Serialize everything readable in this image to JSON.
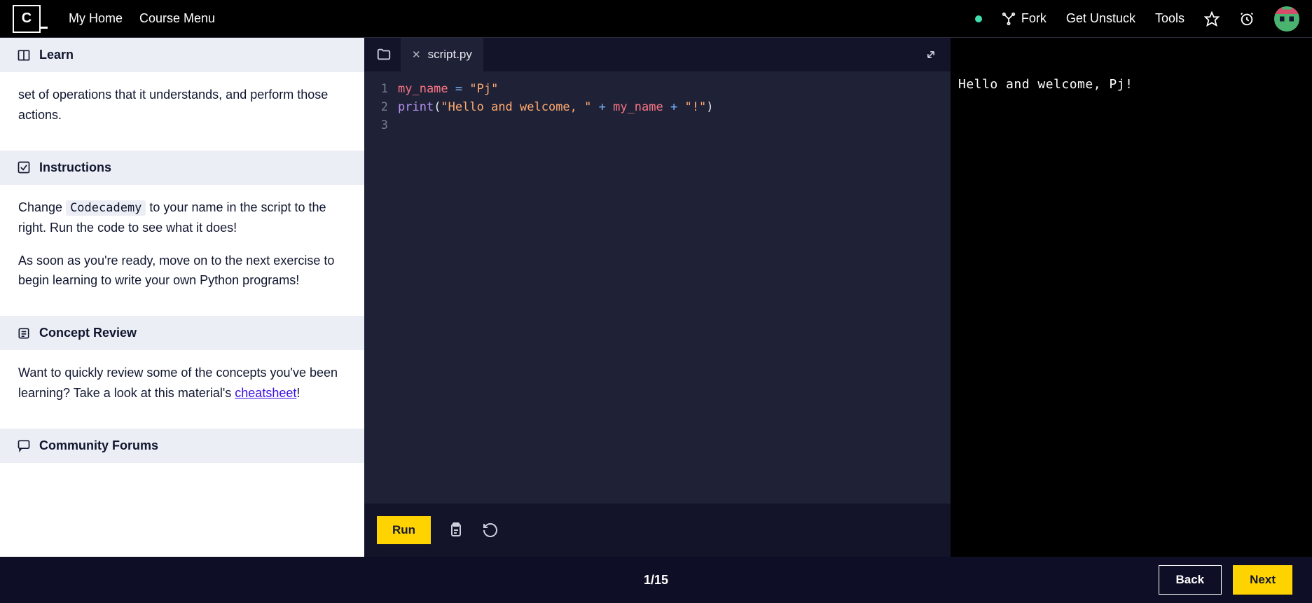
{
  "topbar": {
    "nav_home": "My Home",
    "nav_course": "Course Menu",
    "fork": "Fork",
    "unstuck": "Get Unstuck",
    "tools": "Tools"
  },
  "left": {
    "learn_header": "Learn",
    "learn_body_fragment": "set of operations that it understands, and perform those actions.",
    "instructions_header": "Instructions",
    "instr_pre": "Change ",
    "instr_code": "Codecademy",
    "instr_post": " to your name in the script to the right. Run the code to see what it does!",
    "instr_p2": "As soon as you're ready, move on to the next exercise to begin learning to write your own Python programs!",
    "concept_header": "Concept Review",
    "concept_pre": "Want to quickly review some of the concepts you've been learning? Take a look at this material's ",
    "concept_link": "cheatsheet",
    "concept_post": "!",
    "forums_header": "Community Forums"
  },
  "editor": {
    "tab_name": "script.py",
    "lines": {
      "n1": "1",
      "n2": "2",
      "n3": "3",
      "l1_var": "my_name",
      "l1_eq": " = ",
      "l1_str": "\"Pj\"",
      "l2_fn": "print",
      "l2_open": "(",
      "l2_s1": "\"Hello and welcome, \"",
      "l2_plus1": " + ",
      "l2_var": "my_name",
      "l2_plus2": " + ",
      "l2_s2": "\"!\"",
      "l2_close": ")"
    },
    "run": "Run"
  },
  "terminal": {
    "output": "Hello and welcome, Pj!"
  },
  "bottom": {
    "progress": "1/15",
    "back": "Back",
    "next": "Next"
  }
}
